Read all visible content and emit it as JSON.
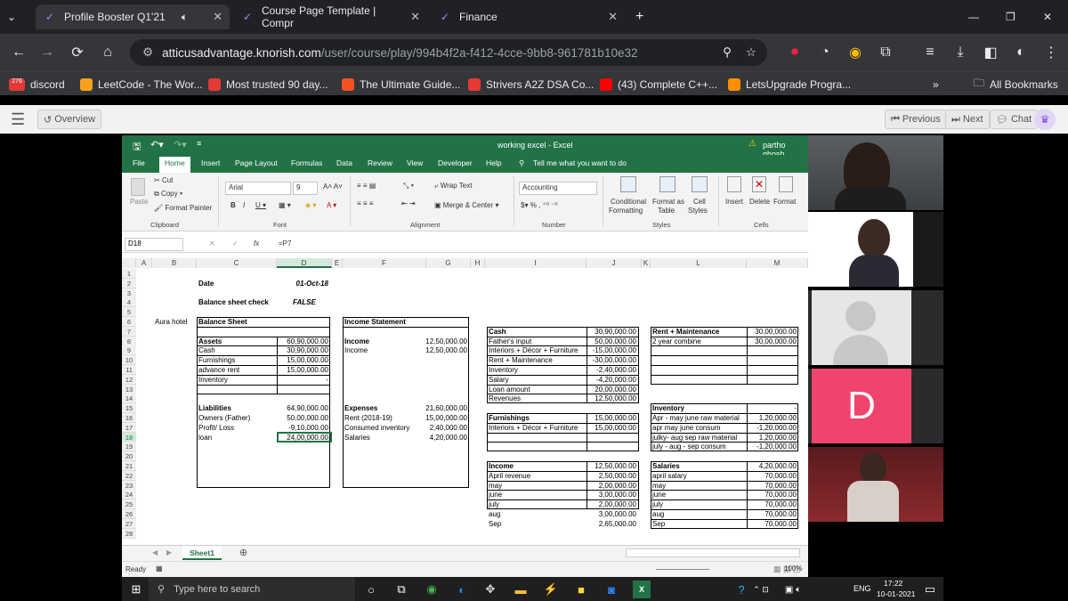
{
  "browser": {
    "tabs": [
      {
        "label": "Profile Booster Q1'21",
        "active": true
      },
      {
        "label": "Course Page Template | Compr",
        "active": false
      },
      {
        "label": "Finance",
        "active": false
      }
    ],
    "url_host": "atticusadvantage.knorish.com",
    "url_path": "/user/course/play/994b4f2a-f412-4cce-9bb8-961781b10e32",
    "bookmarks": [
      {
        "label": "discord",
        "badge": "276"
      },
      {
        "label": "LeetCode - The Wor..."
      },
      {
        "label": "Most trusted 90 day..."
      },
      {
        "label": "The Ultimate Guide..."
      },
      {
        "label": "Strivers A2Z DSA Co..."
      },
      {
        "label": "(43) Complete C++..."
      },
      {
        "label": "LetsUpgrade Progra..."
      }
    ],
    "all_bookmarks": "All Bookmarks"
  },
  "course": {
    "overview": "Overview",
    "previous": "Previous",
    "next": "Next",
    "chat": "Chat"
  },
  "excel": {
    "title": "working excel - Excel",
    "user": "partho ghosh",
    "menus": [
      "File",
      "Home",
      "Insert",
      "Page Layout",
      "Formulas",
      "Data",
      "Review",
      "View",
      "Developer",
      "Help"
    ],
    "tell_me": "Tell me what you want to do",
    "ribbon": {
      "cut": "Cut",
      "copy": "Copy",
      "paste": "Paste",
      "format_painter": "Format Painter",
      "clipboard": "Clipboard",
      "font_name": "Arial",
      "font_size": "9",
      "font": "Font",
      "wrap_text": "Wrap Text",
      "merge_center": "Merge & Center",
      "alignment": "Alignment",
      "number_format": "Accounting",
      "number": "Number",
      "conditional": "Conditional",
      "formatting": "Formatting",
      "format_as": "Format as",
      "table": "Table",
      "cell": "Cell",
      "styles_lbl": "Styles",
      "styles": "Styles",
      "insert": "Insert",
      "delete": "Delete",
      "format": "Format",
      "cells": "Cells"
    },
    "name_box": "D18",
    "formula": "=P7",
    "columns": [
      "A",
      "B",
      "C",
      "D",
      "E",
      "F",
      "G",
      "H",
      "I",
      "J",
      "K",
      "L",
      "M"
    ],
    "rows": [
      "1",
      "2",
      "3",
      "4",
      "5",
      "6",
      "7",
      "8",
      "9",
      "10",
      "11",
      "12",
      "13",
      "14",
      "15",
      "16",
      "17",
      "18",
      "19",
      "20",
      "21",
      "22",
      "23",
      "24",
      "25",
      "26",
      "27",
      "28"
    ],
    "cells": {
      "date_label": "Date",
      "date_value": "01-Oct-18",
      "bs_check_label": "Balance sheet check",
      "bs_check_value": "FALSE",
      "company": "Aura hotel",
      "balance_sheet": "Balance Sheet",
      "income_statement": "Income Statement",
      "assets": "Assets",
      "assets_total": "60,90,000.00",
      "cash": "Cash",
      "cash_val": "30,90,000.00",
      "furnishings": "Furnishings",
      "furnishings_val": "15,00,000.00",
      "advance_rent": "advance rent",
      "advance_rent_val": "15,00,000.00",
      "inventory": "Inventory",
      "inventory_val": "-",
      "liabilities": "Liabilities",
      "liabilities_total": "64,90,000.00",
      "owners": "Owners (Father)",
      "owners_val": "50,00,000.00",
      "profit_loss": "Profit/ Loss",
      "profit_loss_val": "-9,10,000.00",
      "loan": "loan",
      "loan_val": "24,00,000.00",
      "income_h": "Income",
      "income_h_val": "12,50,000.00",
      "income": "Income",
      "income_val": "12,50,000.00",
      "expenses": "Expenses",
      "expenses_val": "21,60,000.00",
      "rent": "Rent (2018-19)",
      "rent_val": "15,00,000.00",
      "consumed_inv": "Consumed inventory",
      "consumed_inv_val": "2,40,000.00",
      "salaries_f": "Salaries",
      "salaries_f_val": "4,20,000.00"
    },
    "cash_table": [
      {
        "label": "Cash",
        "value": "30,90,000.00"
      },
      {
        "label": "Father's input",
        "value": "50,00,000.00"
      },
      {
        "label": "Interiors + Décor + Furniture",
        "value": "-15,00,000.00"
      },
      {
        "label": "Rent + Maintenance",
        "value": "-30,00,000.00"
      },
      {
        "label": "Inventory",
        "value": "-2,40,000.00"
      },
      {
        "label": "Salary",
        "value": "-4,20,000.00"
      },
      {
        "label": "Loan amount",
        "value": "20,00,000.00"
      },
      {
        "label": "Revenues",
        "value": "12,50,000.00"
      }
    ],
    "furnishings_table": [
      {
        "label": "Furnishings",
        "value": "15,00,000.00"
      },
      {
        "label": "Interiors + Décor + Furniture",
        "value": "15,00,000.00"
      }
    ],
    "income_table": [
      {
        "label": "Income",
        "value": "12,50,000.00"
      },
      {
        "label": "April revenue",
        "value": "2,50,000.00"
      },
      {
        "label": "may",
        "value": "2,00,000.00"
      },
      {
        "label": "june",
        "value": "3,00,000.00"
      },
      {
        "label": "july",
        "value": "2,00,000.00"
      },
      {
        "label": "aug",
        "value": "3,00,000.00"
      },
      {
        "label": "Sep",
        "value": "2,65,000.00"
      }
    ],
    "rent_table": [
      {
        "label": "Rent + Maintenance",
        "value": "30,00,000.00"
      },
      {
        "label": "2 year combine",
        "value": "30,00,000.00"
      }
    ],
    "inventory_table": [
      {
        "label": "Inventory",
        "value": "-"
      },
      {
        "label": "Apr - may june raw material",
        "value": "1,20,000.00"
      },
      {
        "label": "apr may june consum",
        "value": "-1,20,000.00"
      },
      {
        "label": "julky- aug sep raw material",
        "value": "1,20,000.00"
      },
      {
        "label": "july - aug - sep consum",
        "value": "-1,20,000.00"
      }
    ],
    "salaries_table": [
      {
        "label": "Salaries",
        "value": "4,20,000.00"
      },
      {
        "label": "april salary",
        "value": "70,000.00"
      },
      {
        "label": "may",
        "value": "70,000.00"
      },
      {
        "label": "june",
        "value": "70,000.00"
      },
      {
        "label": "july",
        "value": "70,000.00"
      },
      {
        "label": "aug",
        "value": "70,000.00"
      },
      {
        "label": "Sep",
        "value": "70,000.00"
      }
    ],
    "sheet_tab": "Sheet1",
    "status": "Ready",
    "zoom": "100%"
  },
  "video": {
    "avatar_letter": "D",
    "avatar_color": "#f0446c"
  },
  "taskbar": {
    "search_placeholder": "Type here to search",
    "language": "ENG",
    "time": "17:22",
    "date": "10-01-2021"
  }
}
